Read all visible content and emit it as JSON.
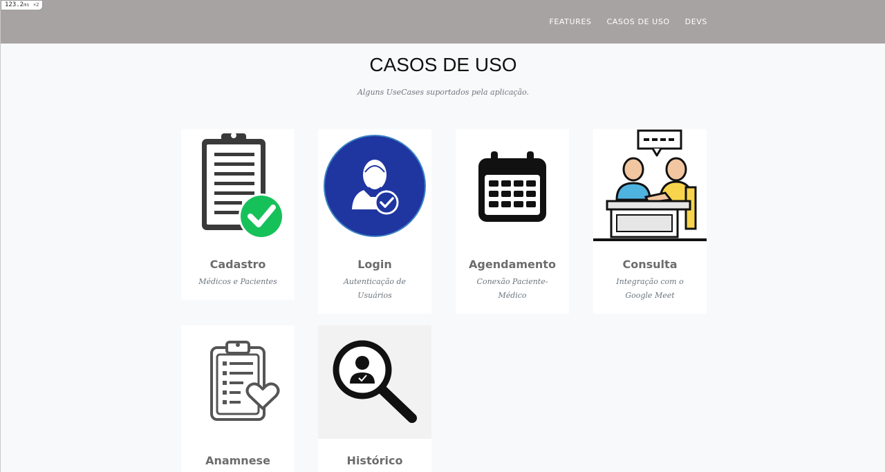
{
  "debug_badge": {
    "value": "123.2",
    "unit": "ms",
    "multiplier": "×2"
  },
  "nav": {
    "links": [
      "FEATURES",
      "CASOS DE USO",
      "DEVS"
    ]
  },
  "section": {
    "title": "CASOS DE USO",
    "subtitle": "Alguns UseCases suportados pela aplicação."
  },
  "cards": [
    {
      "title": "Cadastro",
      "description": "Médicos e Pacientes",
      "icon": "clipboard-check-icon"
    },
    {
      "title": "Login",
      "description": "Autenticação de Usuários",
      "icon": "user-verified-icon"
    },
    {
      "title": "Agendamento",
      "description": "Conexão Paciente-Médico",
      "icon": "calendar-icon"
    },
    {
      "title": "Consulta",
      "description": "Integração com o Google Meet",
      "icon": "consultation-icon"
    },
    {
      "title": "Anamnese",
      "description": "",
      "icon": "clipboard-heart-icon"
    },
    {
      "title": "Histórico",
      "description": "",
      "icon": "magnifier-user-icon"
    }
  ],
  "colors": {
    "navbar": "#a8a3a3",
    "background": "#f8f9fa",
    "card_title": "#6c6c6c",
    "check_green": "#16c15a",
    "login_blue": "#1f35a0"
  }
}
